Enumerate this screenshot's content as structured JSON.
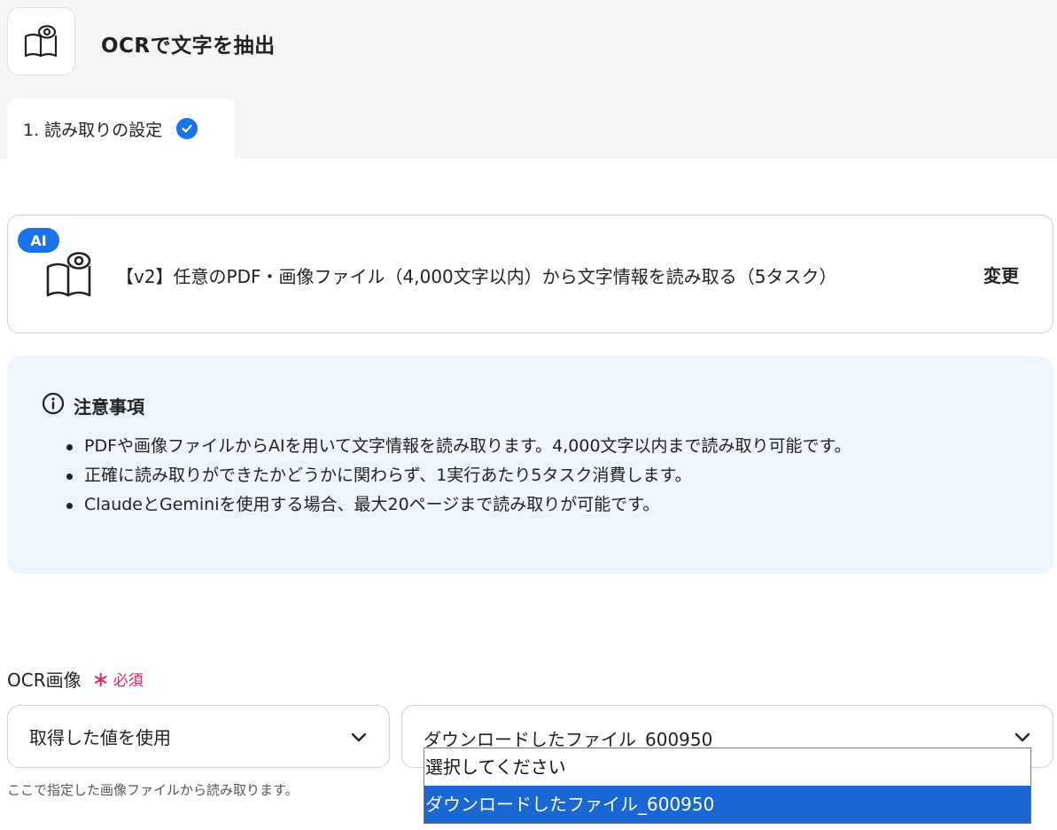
{
  "header": {
    "title": "OCRで文字を抽出",
    "step_tab_label": "1. 読み取りの設定"
  },
  "action": {
    "badge": "AI",
    "label": "【v2】任意のPDF・画像ファイル（4,000文字以内）から文字情報を読み取る（5タスク）",
    "change_label": "変更"
  },
  "notice": {
    "title": "注意事項",
    "items": [
      "PDFや画像ファイルからAIを用いて文字情報を読み取ります。4,000文字以内まで読み取り可能です。",
      "正確に読み取りができたかどうかに関わらず、1実行あたり5タスク消費します。",
      "ClaudeとGeminiを使用する場合、最大20ページまで読み取りが可能です。"
    ]
  },
  "ocr_field": {
    "label": "OCR画像",
    "required_label": "必須",
    "source_select_value": "取得した値を使用",
    "file_select_value": "ダウンロードしたファイル_600950",
    "hint": "ここで指定した画像ファイルから読み取ります。",
    "dropdown_options": [
      "選択してください",
      "ダウンロードしたファイル_600950"
    ]
  },
  "colors": {
    "accent": "#1a73e8",
    "notice_bg": "#eef5fd",
    "required": "#e0245e",
    "option_selected": "#1967d2"
  }
}
